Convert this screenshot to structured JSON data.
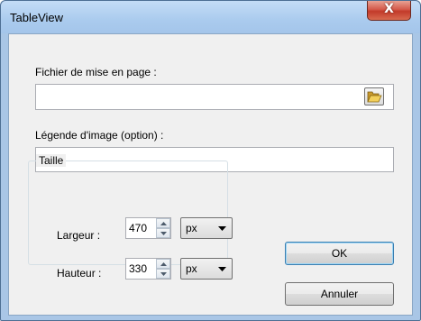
{
  "window": {
    "title": "TableView"
  },
  "titlebar": {
    "close_glyph": "X"
  },
  "layout_file": {
    "label": "Fichier de mise en page :",
    "value": "",
    "browse_icon": "folder-open-icon"
  },
  "caption": {
    "label": "Légende d'image (option) :",
    "value": ""
  },
  "size": {
    "group_label": "Taille",
    "width": {
      "label": "Largeur :",
      "value": "470",
      "unit": "px"
    },
    "height": {
      "label": "Hauteur :",
      "value": "330",
      "unit": "px"
    }
  },
  "buttons": {
    "ok": "OK",
    "cancel": "Annuler"
  },
  "colors": {
    "titlebar": "#aacbee",
    "close_button": "#c23a2a",
    "client_bg": "#f0f0f0",
    "default_button_border": "#3c7fb1"
  }
}
